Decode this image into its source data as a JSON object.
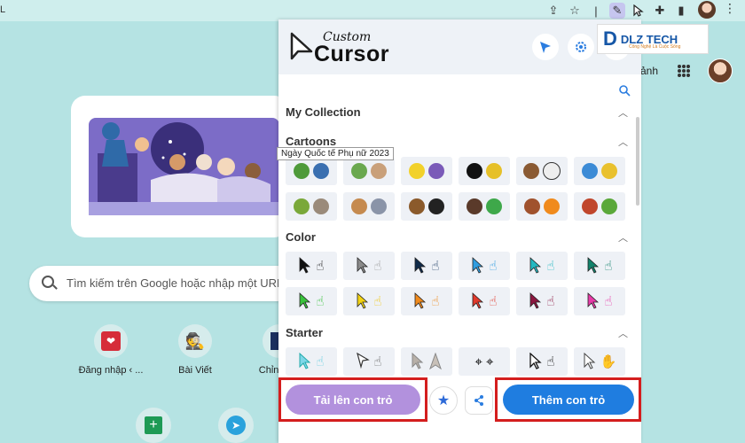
{
  "browser": {
    "tab_edge_text": "L",
    "kebab": "⋮"
  },
  "newtab": {
    "header_text": "ảnh",
    "search_placeholder": "Tìm kiếm trên Google hoặc nhập một URL",
    "shortcuts": [
      {
        "label": "Đăng nhập ‹ ..."
      },
      {
        "label": "Bài Viết"
      },
      {
        "label": "Chỉnh s..."
      }
    ]
  },
  "extension": {
    "logo_top": "Custom",
    "logo_bottom": "Cursor",
    "watermark": {
      "mark": "D",
      "title": "DLZ TECH",
      "subtitle": "Công Nghệ Là Cuộc Sống"
    },
    "sections": {
      "collection": "My Collection",
      "cartoons": "Cartoons",
      "color": "Color",
      "starter": "Starter"
    },
    "tooltip": "Ngày Quốc tế Phụ nữ 2023",
    "cartoon_icons": [
      "ninja-turtle",
      "ninja-turtle-2",
      "minion",
      "felix-cat",
      "bear-panda",
      "bird-pair",
      "shrek",
      "tom-jerry",
      "boy-cat",
      "ben-ten",
      "garfield",
      "grinch"
    ],
    "color_cursors": [
      {
        "arrow": "#111111",
        "hand": "#111111"
      },
      {
        "arrow": "#8a8a8a",
        "hand": "#9a9a9a"
      },
      {
        "arrow": "#0f2a4a",
        "hand": "#13355e"
      },
      {
        "arrow": "#2f9de0",
        "hand": "#2f9de0"
      },
      {
        "arrow": "#23b9c2",
        "hand": "#23b9c2"
      },
      {
        "arrow": "#12826b",
        "hand": "#12826b"
      },
      {
        "arrow": "#39c33c",
        "hand": "#39c33c"
      },
      {
        "arrow": "#f2d212",
        "hand": "#f2c812"
      },
      {
        "arrow": "#f08a1c",
        "hand": "#f08a1c"
      },
      {
        "arrow": "#e2392c",
        "hand": "#e2392c"
      },
      {
        "arrow": "#8c1640",
        "hand": "#8c1640"
      },
      {
        "arrow": "#e83aa8",
        "hand": "#e83aa8"
      }
    ],
    "starter_cursors": [
      "aqua-arrow",
      "outline-arrow",
      "grey-arrow",
      "crosshair",
      "black-outline",
      "white-outline"
    ],
    "buttons": {
      "upload": "Tải lên con trỏ",
      "add": "Thêm con trỏ"
    },
    "colors": {
      "upload_bg": "#b291dd",
      "add_bg": "#1f7de0",
      "highlight": "#d41e1e"
    }
  }
}
